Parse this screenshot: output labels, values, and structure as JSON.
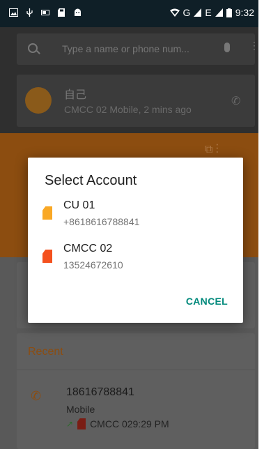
{
  "status_bar": {
    "time": "9:32",
    "network": "G",
    "network2": "E"
  },
  "search": {
    "placeholder": "Type a name or phone num..."
  },
  "self_contact": {
    "name": "自己",
    "subtitle": "CMCC 02 Mobile, 2 mins ago"
  },
  "dialog": {
    "title": "Select Account",
    "accounts": [
      {
        "name": "CU 01",
        "number": "+8618616788841",
        "sim_color": "#f9a825"
      },
      {
        "name": "CMCC 02",
        "number": "13524672610",
        "sim_color": "#f4511e"
      }
    ],
    "cancel_label": "CANCEL"
  },
  "recent": {
    "title": "Recent",
    "number": "18616788841",
    "type": "Mobile",
    "meta": "CMCC 029:29 PM"
  },
  "colors": {
    "accent_orange": "#8c4d10",
    "cancel_teal": "#00897b"
  }
}
